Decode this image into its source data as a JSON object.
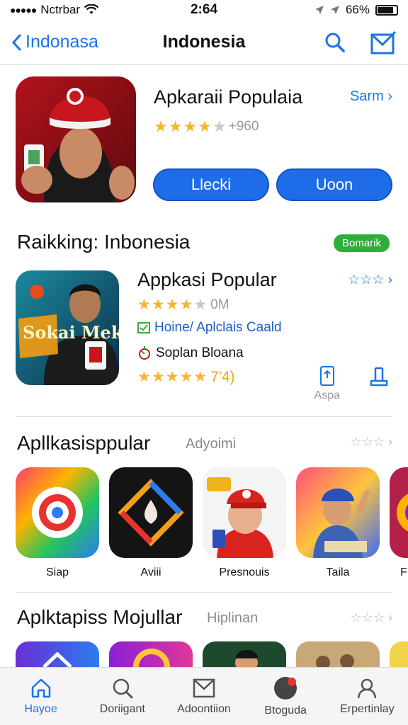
{
  "status_bar": {
    "carrier": "Nctrbar",
    "time": "2:64",
    "battery": "66%"
  },
  "nav": {
    "back_label": "Indonasa",
    "title": "Indonesia"
  },
  "featured": {
    "title": "Apkaraii Populaia",
    "link": "Sarm",
    "rating_stars": "★★★★",
    "rating_dim": "★",
    "rating_count": "+960",
    "button1": "Llecki",
    "button2": "Uoon"
  },
  "ranking": {
    "heading": "Raikking: Inbonesia",
    "badge": "Bomarik",
    "app": {
      "title": "Appkasi Popular",
      "link_stars": "☆☆☆",
      "rating_stars": "★★★★",
      "rating_dim": "★",
      "rating_count": "0M",
      "category": "Hoine/ Aplclais Caald",
      "developer": "Soplan Bloana",
      "rating2_stars": "★★★★★",
      "rating2_count": "7'4)",
      "action_label": "Aspa",
      "icon_text": "Sokai Mekun"
    }
  },
  "popular": {
    "heading": "Apllkasisppular",
    "sub": "Adyoimi",
    "arrow": "☆☆☆",
    "apps": [
      {
        "name": "Siap"
      },
      {
        "name": "Aviii"
      },
      {
        "name": "Presnouis"
      },
      {
        "name": "Taila"
      },
      {
        "name": "F"
      }
    ]
  },
  "modular": {
    "heading": "Aplktapiss Mojullar",
    "sub": "Hiplinan",
    "arrow": "☆☆☆"
  },
  "tabs": [
    {
      "label": "Hayoe",
      "icon": "home-icon"
    },
    {
      "label": "Doriigant",
      "icon": "search-icon"
    },
    {
      "label": "Adoontiion",
      "icon": "mail-icon"
    },
    {
      "label": "Btoguda",
      "icon": "avatar-icon"
    },
    {
      "label": "Erpertinlay",
      "icon": "profile-icon"
    }
  ],
  "colors": {
    "accent": "#1a73e8",
    "star": "#f7b42c",
    "badge": "#2fae3a"
  }
}
